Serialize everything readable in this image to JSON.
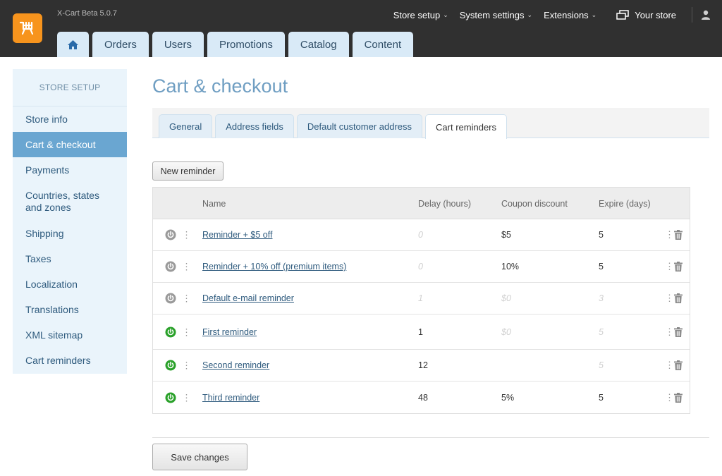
{
  "app": {
    "version": "X-Cart Beta 5.0.7"
  },
  "topnav": {
    "store_setup": "Store setup",
    "system_settings": "System settings",
    "extensions": "Extensions",
    "your_store": "Your store"
  },
  "tabs": [
    "Orders",
    "Users",
    "Promotions",
    "Catalog",
    "Content"
  ],
  "sidebar": {
    "heading": "STORE SETUP",
    "items": [
      "Store info",
      "Cart & checkout",
      "Payments",
      "Countries, states and zones",
      "Shipping",
      "Taxes",
      "Localization",
      "Translations",
      "XML sitemap",
      "Cart reminders"
    ],
    "active_index": 1
  },
  "page": {
    "title": "Cart & checkout"
  },
  "subtabs": [
    "General",
    "Address fields",
    "Default customer address",
    "Cart reminders"
  ],
  "active_subtab": 3,
  "buttons": {
    "new_reminder": "New reminder",
    "save": "Save changes"
  },
  "table": {
    "headers": {
      "name": "Name",
      "delay": "Delay (hours)",
      "coupon": "Coupon discount",
      "expire": "Expire (days)"
    },
    "rows": [
      {
        "enabled": false,
        "name": "Reminder + $5 off",
        "delay": "0",
        "coupon": "$5",
        "expire": "5",
        "delay_muted": true,
        "coupon_muted": false,
        "expire_muted": false
      },
      {
        "enabled": false,
        "name": "Reminder + 10% off (premium items)",
        "delay": "0",
        "coupon": "10%",
        "expire": "5",
        "delay_muted": true,
        "coupon_muted": false,
        "expire_muted": false
      },
      {
        "enabled": false,
        "name": "Default e-mail reminder",
        "delay": "1",
        "coupon": "$0",
        "expire": "3",
        "delay_muted": true,
        "coupon_muted": true,
        "expire_muted": true
      },
      {
        "enabled": true,
        "name": "First reminder",
        "delay": "1",
        "coupon": "$0",
        "expire": "5",
        "delay_muted": false,
        "coupon_muted": true,
        "expire_muted": true
      },
      {
        "enabled": true,
        "name": "Second reminder",
        "delay": "12",
        "coupon": "",
        "expire": "5",
        "delay_muted": false,
        "coupon_muted": false,
        "expire_muted": true
      },
      {
        "enabled": true,
        "name": "Third reminder",
        "delay": "48",
        "coupon": "5%",
        "expire": "5",
        "delay_muted": false,
        "coupon_muted": false,
        "expire_muted": false
      }
    ]
  },
  "colors": {
    "power_on": "#2aa12a",
    "power_off": "#9a9a9a",
    "accent": "#6aa6d1",
    "logo": "#f7941d"
  }
}
